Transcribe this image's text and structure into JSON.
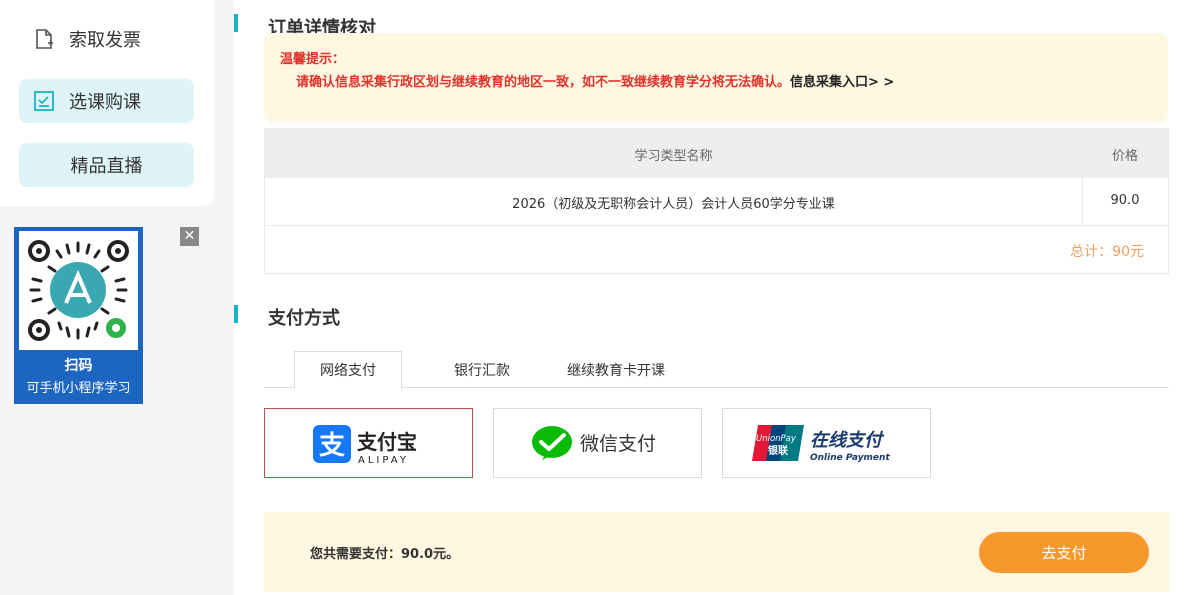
{
  "sidebar": {
    "items": [
      {
        "label": "索取发票",
        "icon": "invoice-icon"
      },
      {
        "label": "选课购课",
        "icon": "checklist-icon"
      },
      {
        "label": "精品直播"
      }
    ]
  },
  "qr": {
    "title": "扫码",
    "subtitle": "可手机小程序学习",
    "close": "✕"
  },
  "order": {
    "title": "订单详情核对",
    "notice_title": "温馨提示：",
    "notice_body": "请确认信息采集行政区划与继续教育的地区一致，如不一致继续教育学分将无法确认。",
    "notice_link": "信息采集入口> >",
    "table": {
      "col_name": "学习类型名称",
      "col_price": "价格",
      "rows": [
        {
          "name": "2026（初级及无职称会计人员）会计人员60学分专业课",
          "price": "90.0"
        }
      ],
      "total": "总计：90元"
    }
  },
  "payment": {
    "title": "支付方式",
    "tabs": [
      "网络支付",
      "银行汇款",
      "继续教育卡开课"
    ],
    "methods": {
      "alipay_cn": "支付宝",
      "alipay_en": "ALIPAY",
      "wechat": "微信支付",
      "unionpay_logo": "UnionPay",
      "unionpay_logo_cn": "银联",
      "unionpay_cn": "在线支付",
      "unionpay_en": "Online Payment"
    },
    "summary": "您共需要支付：90.0元。",
    "button": "去支付"
  },
  "colors": {
    "accent": "#1ab3c6",
    "alipay": "#1677ff",
    "wechat": "#09bb07",
    "pay_button": "#f7982c",
    "warning": "#e0322b"
  }
}
